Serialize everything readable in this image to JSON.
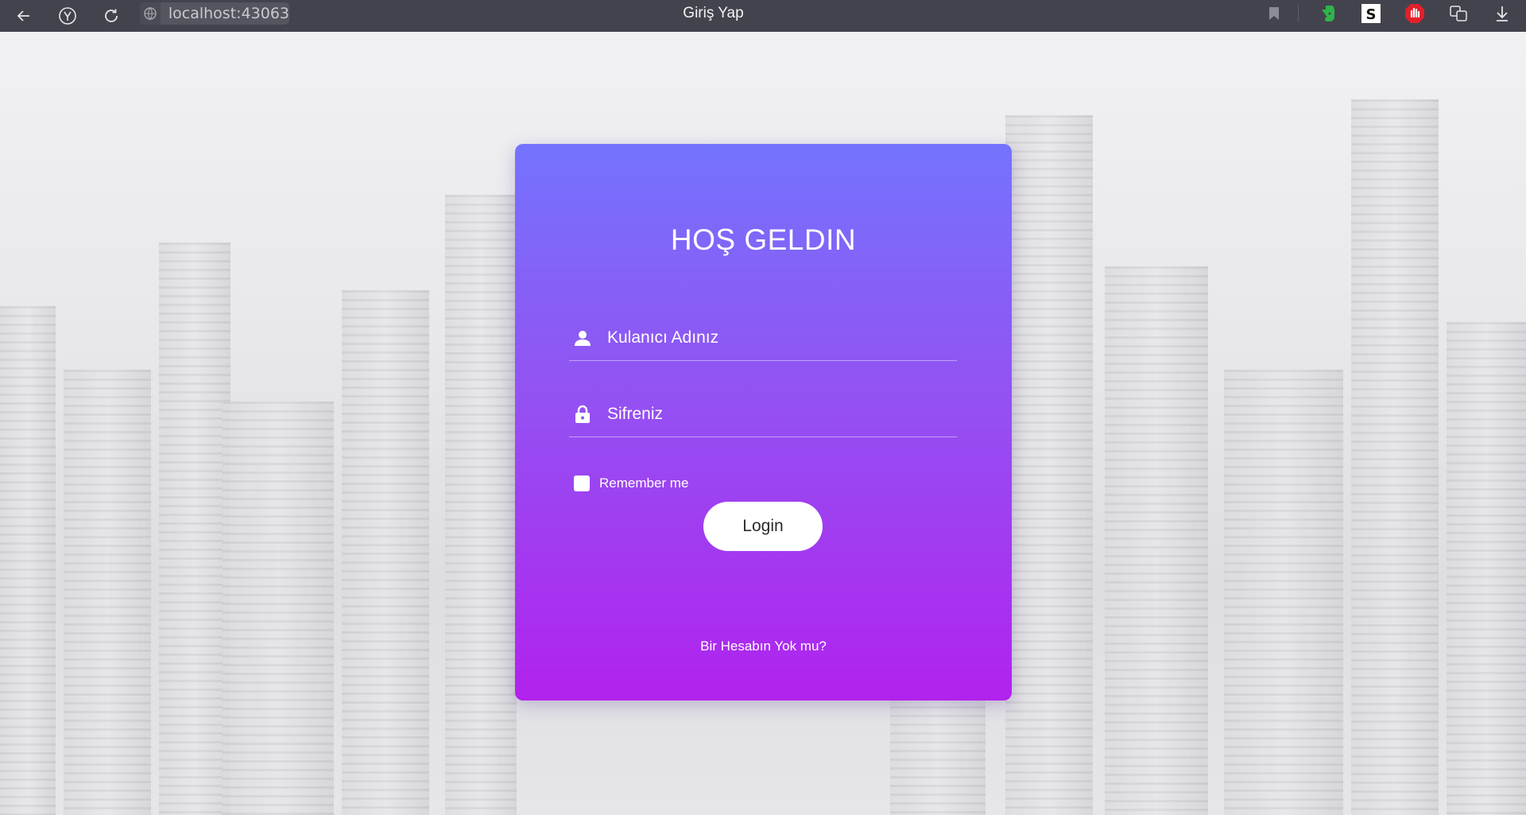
{
  "browser": {
    "tab_title": "Giriş Yap",
    "address": "localhost:43063",
    "icons": [
      "back-arrow-icon",
      "yandex-icon",
      "reload-icon",
      "site-info-icon",
      "bookmark-icon",
      "evernote-icon",
      "s-extension-icon",
      "adblock-icon",
      "translate-icon",
      "download-icon"
    ]
  },
  "login": {
    "title": "HOŞ GELDIN",
    "username_placeholder": "Kulanıcı Adınız",
    "password_placeholder": "Sifreniz",
    "remember_label": "Remember me",
    "login_label": "Login",
    "signup_link": "Bir Hesabın Yok mu?"
  },
  "colors": {
    "card_top": "#7473fe",
    "card_bottom": "#b122ee",
    "browser_bar": "#43434d"
  }
}
